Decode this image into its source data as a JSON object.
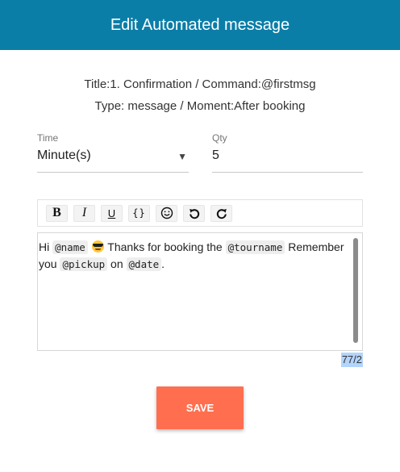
{
  "header": {
    "title": "Edit Automated message"
  },
  "info": {
    "line1": "Title:1. Confirmation / Command:@firstmsg",
    "line2": "Type: message / Moment:After booking"
  },
  "time_field": {
    "label": "Time",
    "value": "Minute(s)"
  },
  "qty_field": {
    "label": "Qty",
    "value": "5"
  },
  "toolbar": {
    "bold": "B",
    "italic": "I",
    "underline": "U",
    "code": "{}",
    "emoji_icon": "smiley-icon",
    "undo_icon": "undo-icon",
    "redo_icon": "redo-icon"
  },
  "editor": {
    "line1": {
      "t1": "Hi ",
      "tag_name": "@name",
      "emoji": "sunglasses-emoji",
      "t2": " Thanks for booking the ",
      "tag_tourname": "@tourname",
      "t3": " Remember"
    },
    "line2": {
      "t1": "you ",
      "tag_pickup": "@pickup",
      "t2": " on ",
      "tag_date": "@date",
      "t3": "."
    }
  },
  "counter": "77/2",
  "save_label": "SAVE",
  "colors": {
    "header_bg": "#0b7ea8",
    "save_bg": "#ff6f4f",
    "selection": "#b3d4fc"
  }
}
